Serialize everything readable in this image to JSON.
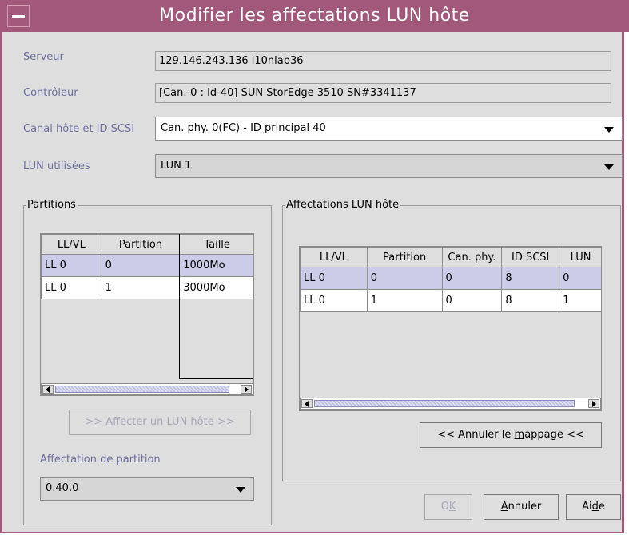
{
  "window": {
    "title": "Modifier les affectations LUN hôte"
  },
  "form": {
    "server_label": "Serveur",
    "server_value": "129.146.243.136 l10nlab36",
    "controller_label": "Contrôleur",
    "controller_value": "[Can.-0 : Id-40] SUN StorEdge 3510 SN#3341137",
    "channel_label": "Canal hôte et ID SCSI",
    "channel_value": "Can. phy. 0(FC) - ID principal 40",
    "lun_label": "LUN utilisées",
    "lun_value": "LUN 1"
  },
  "partitions": {
    "title": "Partitions",
    "columns": [
      "LL/VL",
      "Partition",
      "Taille"
    ],
    "rows": [
      [
        "LL 0",
        "0",
        "1000Mo"
      ],
      [
        "LL 0",
        "1",
        "3000Mo"
      ]
    ],
    "assign_btn": {
      "pre": ">> ",
      "key": "A",
      "post": "ffecter un LUN hôte >>"
    },
    "assignment_label": "Affectation de partition",
    "assignment_value": "0.40.0"
  },
  "mappings": {
    "title": "Affectations LUN hôte",
    "columns": [
      "LL/VL",
      "Partition",
      "Can. phy.",
      "ID SCSI",
      "LUN"
    ],
    "rows": [
      [
        "LL 0",
        "0",
        "0",
        "8",
        "0"
      ],
      [
        "LL 0",
        "1",
        "0",
        "8",
        "1"
      ]
    ],
    "unmap_btn": {
      "pre": "<< Annuler le ",
      "key": "m",
      "post": "appage <<"
    }
  },
  "buttons": {
    "ok": {
      "pre": "O",
      "key": "K",
      "post": ""
    },
    "cancel": {
      "pre": "",
      "key": "A",
      "post": "nnuler"
    },
    "help": {
      "pre": "Ai",
      "key": "d",
      "post": "e"
    }
  }
}
